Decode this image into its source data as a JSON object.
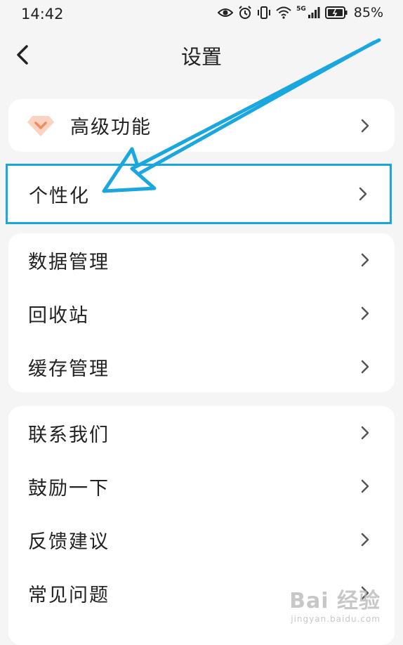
{
  "status_bar": {
    "time": "14:42",
    "network": "5G",
    "battery": "85%"
  },
  "header": {
    "title": "设置",
    "back_icon": "chevron-left-icon"
  },
  "sections": {
    "premium": {
      "icon": "gem-icon",
      "label": "高级功能"
    },
    "personalize": {
      "label": "个性化"
    },
    "data_group": [
      {
        "label": "数据管理"
      },
      {
        "label": "回收站"
      },
      {
        "label": "缓存管理"
      }
    ],
    "support_group": [
      {
        "label": "联系我们"
      },
      {
        "label": "鼓励一下"
      },
      {
        "label": "反馈建议"
      },
      {
        "label": "常见问题"
      }
    ]
  },
  "annotation": {
    "color": "#1aa7e0"
  },
  "watermark": {
    "main": "Bai 经验",
    "sub": "jingyan.baidu.com"
  },
  "colors": {
    "background": "#f5f5f5",
    "card": "#ffffff",
    "accent_gem": "#f4a98a",
    "highlight": "#1aa7e0"
  }
}
